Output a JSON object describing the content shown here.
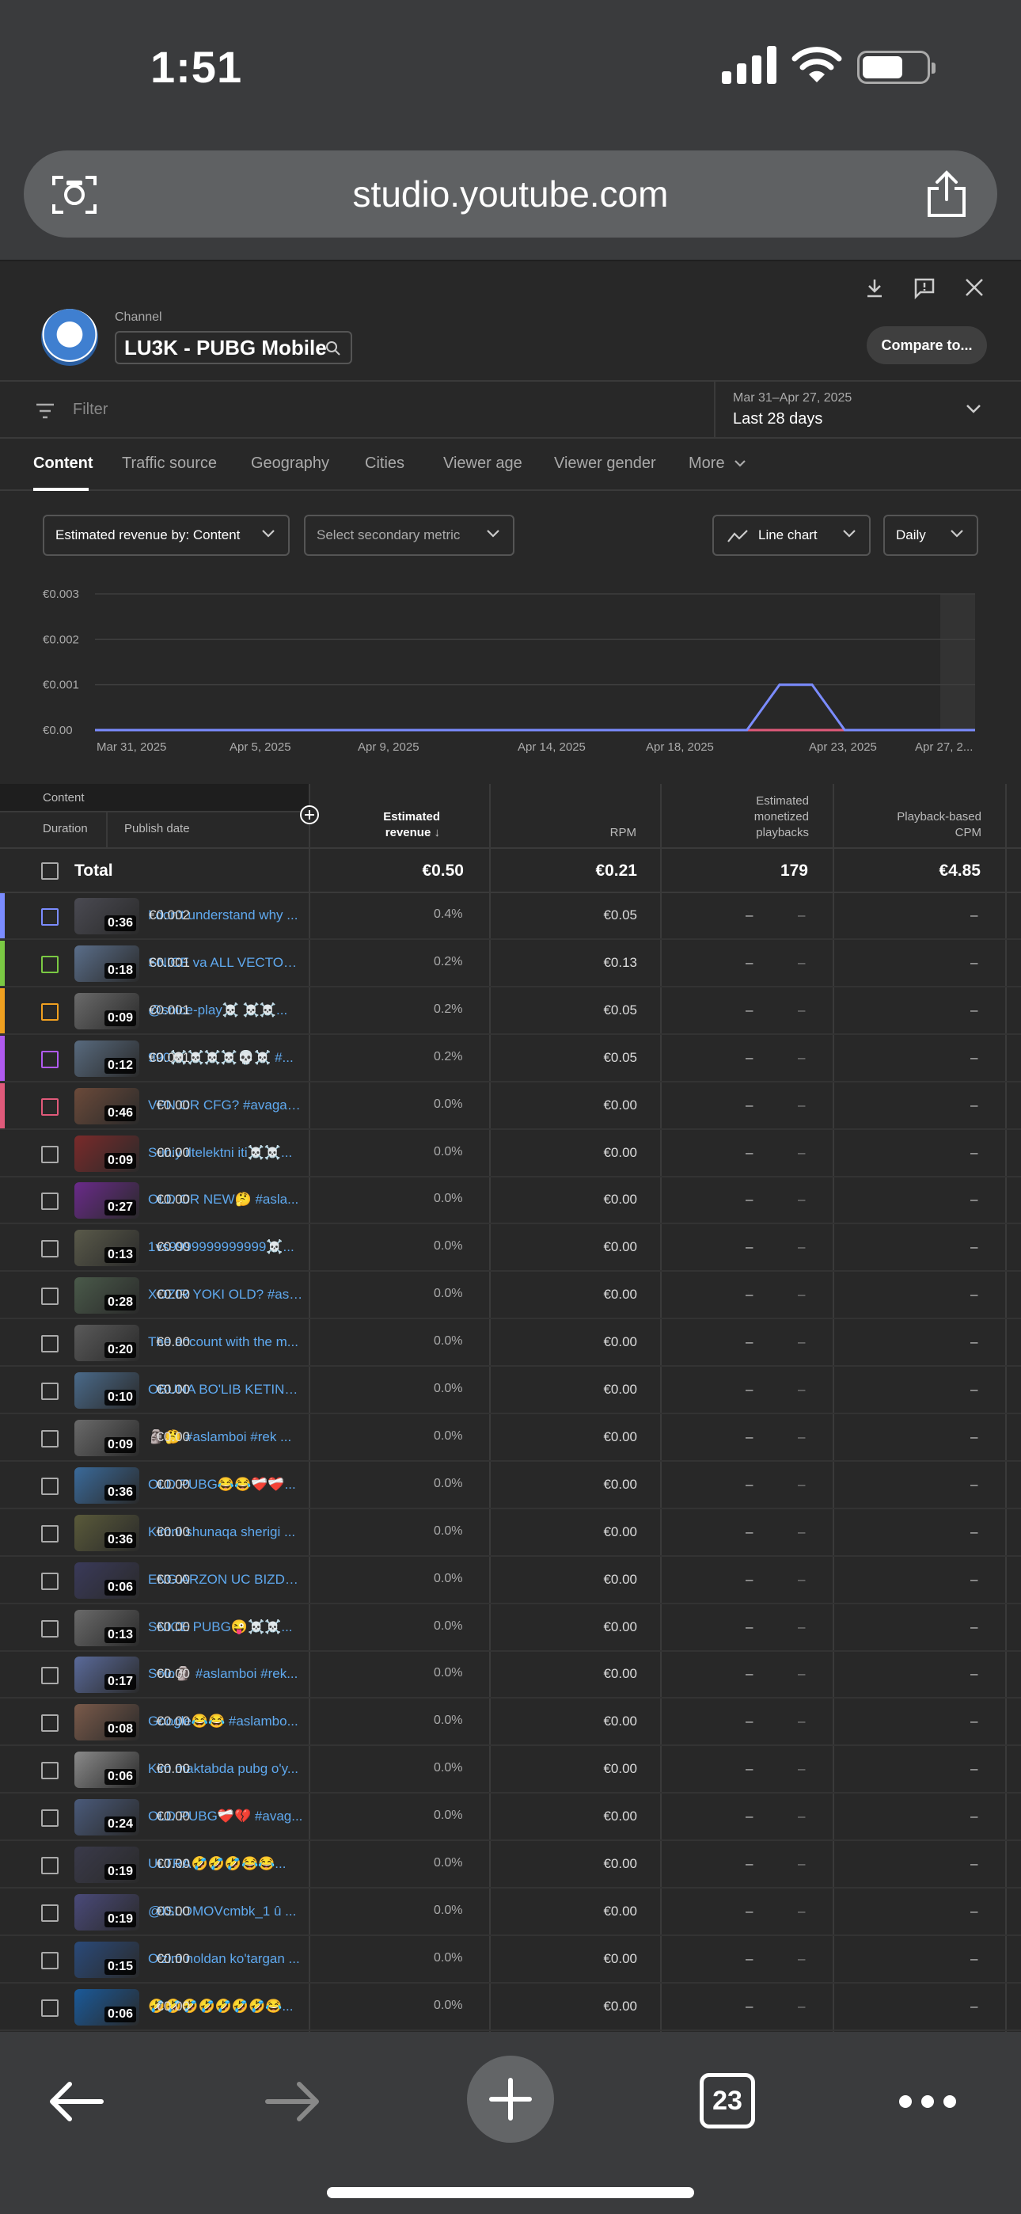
{
  "status_bar": {
    "time": "1:51"
  },
  "browser": {
    "url": "studio.youtube.com",
    "tab_count": "23"
  },
  "header": {
    "channel_label": "Channel",
    "channel_name": "LU3K - PUBG Mobile",
    "compare_label": "Compare to..."
  },
  "filter": {
    "placeholder": "Filter",
    "date_range": "Mar 31–Apr 27, 2025",
    "date_preset": "Last 28 days"
  },
  "tabs": [
    "Content",
    "Traffic source",
    "Geography",
    "Cities",
    "Viewer age",
    "Viewer gender",
    "More"
  ],
  "controls": {
    "metric": "Estimated revenue by: Content",
    "secondary": "Select secondary metric",
    "chart_type": "Line chart",
    "interval": "Daily"
  },
  "chart_data": {
    "type": "line",
    "y_ticks": [
      "€0.003",
      "€0.002",
      "€0.001",
      "€0.00"
    ],
    "x_ticks": [
      "Mar 31, 2025",
      "Apr 5, 2025",
      "Apr 9, 2025",
      "Apr 14, 2025",
      "Apr 18, 2025",
      "Apr 23, 2025",
      "Apr 27, 2..."
    ],
    "ylim": [
      0,
      0.003
    ],
    "x_count": 28,
    "series": [
      {
        "color": "#7b8cff",
        "values": [
          0,
          0,
          0,
          0,
          0,
          0,
          0,
          0,
          0,
          0,
          0,
          0,
          0,
          0,
          0,
          0,
          0,
          0,
          0,
          0,
          0,
          0.001,
          0.001,
          0,
          0,
          0,
          0,
          0
        ]
      },
      {
        "color": "#e05a7a",
        "values": [
          0,
          0,
          0,
          0,
          0,
          0,
          0,
          0,
          0,
          0,
          0,
          0,
          0,
          0,
          0,
          0,
          0,
          0,
          0,
          0,
          0,
          0,
          0,
          0,
          0,
          0,
          0,
          0
        ]
      }
    ]
  },
  "table": {
    "header": {
      "content": "Content",
      "duration": "Duration",
      "publish_date": "Publish date",
      "revenue_l1": "Estimated",
      "revenue_l2": "revenue",
      "rpm": "RPM",
      "mp_l1": "Estimated",
      "mp_l2": "monetized",
      "mp_l3": "playbacks",
      "cpm_l1": "Playback-based",
      "cpm_l2": "CPM"
    },
    "total": {
      "label": "Total",
      "revenue": "€0.50",
      "rpm": "€0.21",
      "playbacks": "179",
      "cpm": "€4.85"
    },
    "rows": [
      {
        "color": "#7b8cff",
        "duration": "0:36",
        "title": "I don't understand why ...",
        "revenue": "€0.002",
        "pct": "0.4%",
        "rpm": "€0.05",
        "thumb": "#4a4a52"
      },
      {
        "color": "#7ac943",
        "duration": "0:18",
        "title": "SNICE va ALL VECTOR ...",
        "revenue": "€0.001",
        "pct": "0.2%",
        "rpm": "€0.13",
        "thumb": "#5a6e8a"
      },
      {
        "color": "#f0a020",
        "duration": "0:09",
        "title": "@snice-play☠️ ☠️☠️...",
        "revenue": "€0.001",
        "pct": "0.2%",
        "rpm": "€0.05",
        "thumb": "#6a6a6a"
      },
      {
        "color": "#b05af0",
        "duration": "0:12",
        "title": "990☠️☠️☠️☠️💀☠️ #...",
        "revenue": "€0.001",
        "pct": "0.2%",
        "rpm": "€0.05",
        "thumb": "#586a7e"
      },
      {
        "color": "#e05a7a",
        "duration": "0:46",
        "title": "VPN OR CFG? #avagadr...",
        "revenue": "€0.00",
        "pct": "0.0%",
        "rpm": "€0.00",
        "thumb": "#6b4a3a"
      },
      {
        "color": "",
        "duration": "0:09",
        "title": "Suniy iltelektni iti☠️☠️...",
        "revenue": "€0.00",
        "pct": "0.0%",
        "rpm": "€0.00",
        "thumb": "#7a2a2a"
      },
      {
        "color": "",
        "duration": "0:27",
        "title": "OLD OR NEW🤔 #asla...",
        "revenue": "€0.00",
        "pct": "0.0%",
        "rpm": "€0.00",
        "thumb": "#6a2a8a"
      },
      {
        "color": "",
        "duration": "0:13",
        "title": "1vs9999999999999☠️...",
        "revenue": "€0.00",
        "pct": "0.0%",
        "rpm": "€0.00",
        "thumb": "#5a5a4a"
      },
      {
        "color": "",
        "duration": "0:28",
        "title": "XOZIR YOKI OLD? #asla...",
        "revenue": "€0.00",
        "pct": "0.0%",
        "rpm": "€0.00",
        "thumb": "#4a5a4a"
      },
      {
        "color": "",
        "duration": "0:20",
        "title": "The account with the m...",
        "revenue": "€0.00",
        "pct": "0.0%",
        "rpm": "€0.00",
        "thumb": "#5a5a5a"
      },
      {
        "color": "",
        "duration": "0:10",
        "title": "OBUNA BO'LIB KETING ...",
        "revenue": "€0.00",
        "pct": "0.0%",
        "rpm": "€0.00",
        "thumb": "#4a6a8a"
      },
      {
        "color": "",
        "duration": "0:09",
        "title": "🗿🤔 #aslamboi #rek ...",
        "revenue": "€0.00",
        "pct": "0.0%",
        "rpm": "€0.00",
        "thumb": "#6a6a6a"
      },
      {
        "color": "",
        "duration": "0:36",
        "title": "OLD PUBG😂😂❤️‍🩹❤️‍🩹...",
        "revenue": "€0.00",
        "pct": "0.0%",
        "rpm": "€0.00",
        "thumb": "#3a6a9a"
      },
      {
        "color": "",
        "duration": "0:36",
        "title": "Kimni shunaqa sherigi ...",
        "revenue": "€0.00",
        "pct": "0.0%",
        "rpm": "€0.00",
        "thumb": "#5a5a3a"
      },
      {
        "color": "",
        "duration": "0:06",
        "title": "ENG ARZON UC BIZDA ...",
        "revenue": "€0.00",
        "pct": "0.0%",
        "rpm": "€0.00",
        "thumb": "#3a3a5a"
      },
      {
        "color": "",
        "duration": "0:13",
        "title": "SNICE PUBG😜☠️☠️...",
        "revenue": "€0.00",
        "pct": "0.0%",
        "rpm": "€0.00",
        "thumb": "#6a6a6a"
      },
      {
        "color": "",
        "duration": "0:17",
        "title": "Solo🗿 #aslamboi #rek...",
        "revenue": "€0.00",
        "pct": "0.0%",
        "rpm": "€0.00",
        "thumb": "#5a6a9a"
      },
      {
        "color": "",
        "duration": "0:08",
        "title": "Google😂😂 #aslambo...",
        "revenue": "€0.00",
        "pct": "0.0%",
        "rpm": "€0.00",
        "thumb": "#7a5a4a"
      },
      {
        "color": "",
        "duration": "0:06",
        "title": "Kim maktabda pubg o'y...",
        "revenue": "€0.00",
        "pct": "0.0%",
        "rpm": "€0.00",
        "thumb": "#8a8a8a"
      },
      {
        "color": "",
        "duration": "0:24",
        "title": "OLD PUBG❤️‍🩹💔 #avag...",
        "revenue": "€0.00",
        "pct": "0.0%",
        "rpm": "€0.00",
        "thumb": "#4a5a7a"
      },
      {
        "color": "",
        "duration": "0:19",
        "title": "ULTRA🤣🤣🤣😂😂...",
        "revenue": "€0.00",
        "pct": "0.0%",
        "rpm": "€0.00",
        "thumb": "#3a3a4a"
      },
      {
        "color": "",
        "duration": "0:19",
        "title": "@ISLOMOVcmbk_1 û ...",
        "revenue": "€0.00",
        "pct": "0.0%",
        "rpm": "€0.00",
        "thumb": "#4a4a7a"
      },
      {
        "color": "",
        "duration": "0:15",
        "title": "O'zim noldan ko'targan ...",
        "revenue": "€0.00",
        "pct": "0.0%",
        "rpm": "€0.00",
        "thumb": "#2a4a7a"
      },
      {
        "color": "",
        "duration": "0:06",
        "title": "🤣🤣🤣🤣🤣🤣🤣😂...",
        "revenue": "€0.00",
        "pct": "0.0%",
        "rpm": "€0.00",
        "thumb": "#1a5a9a"
      }
    ],
    "dash": "–"
  }
}
